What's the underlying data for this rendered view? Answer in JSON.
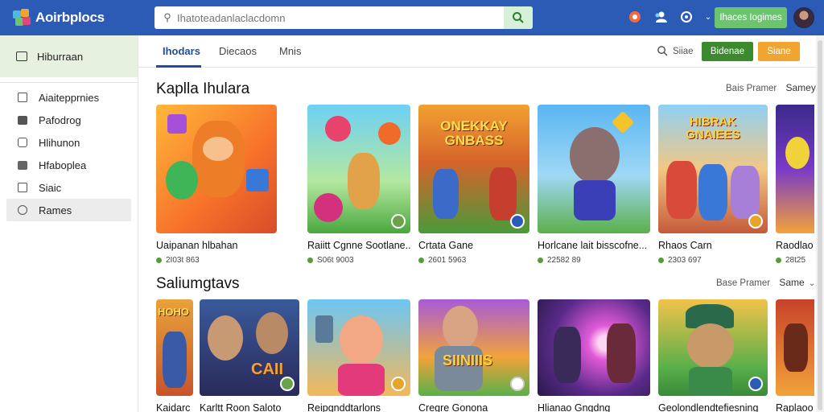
{
  "app": {
    "logo_text": "Aoirbplocs"
  },
  "search": {
    "placeholder": "Ihatoteadanlaclacdomn"
  },
  "topbar": {
    "cta_label": "Ihaces Iogimes",
    "colors": {
      "bar": "#2b5bb5",
      "cta": "#6cc46f"
    }
  },
  "sidebar": {
    "header": "Hiburraan",
    "items": [
      {
        "label": "Aiaitepprnies",
        "icon": "grid-icon"
      },
      {
        "label": "Pafodrog",
        "icon": "bag-icon"
      },
      {
        "label": "Hlihunon",
        "icon": "info-icon"
      },
      {
        "label": "Hfaboplea",
        "icon": "book-icon"
      },
      {
        "label": "Siaic",
        "icon": "square-icon"
      },
      {
        "label": "Rames",
        "icon": "circle-icon",
        "active": true
      }
    ]
  },
  "tabs": [
    "Ihodars",
    "Diecaos",
    "Mnis"
  ],
  "toolbar": {
    "search_label": "Siiae",
    "green_button": "Bidenae",
    "orange_button": "Siane"
  },
  "sections": [
    {
      "title": "Kaplla Ihulara",
      "link_a": "Bais Pramer",
      "link_b": "Samey",
      "cards": [
        {
          "title": "Uaipanan hlbahan",
          "meta": "2I03t 863"
        },
        {
          "title": "Raiitt Cgnne Sootlane..",
          "meta": "S06t 9003"
        },
        {
          "title": "Crtata Gane",
          "meta": "2601 5963"
        },
        {
          "title": "Horlcane lait bisscofne...",
          "meta": "22582 89"
        },
        {
          "title": "Rhaos Carn",
          "meta": "2303 697"
        },
        {
          "title": "Raodlao",
          "meta": "28t25"
        }
      ]
    },
    {
      "title": "Saliumgtavs",
      "link_a": "Base Pramer",
      "link_b": "Same",
      "cards": [
        {
          "title": "Kaidarc"
        },
        {
          "title": "Karltt Roon Saloto"
        },
        {
          "title": "Reipgnddtarlons"
        },
        {
          "title": "Cregre Gonona"
        },
        {
          "title": "Hlianao Gngdng"
        },
        {
          "title": "Geolondlendtefiesning"
        },
        {
          "title": "Raplaoo"
        }
      ]
    }
  ],
  "thumb_text": {
    "r1c3": "ONEKKAY GNBASS",
    "r1c5": "HIBRAK GNAIEES",
    "r2c1": "HOHO",
    "r2c2": "CAII",
    "r2c4": "SIINIIIS"
  }
}
